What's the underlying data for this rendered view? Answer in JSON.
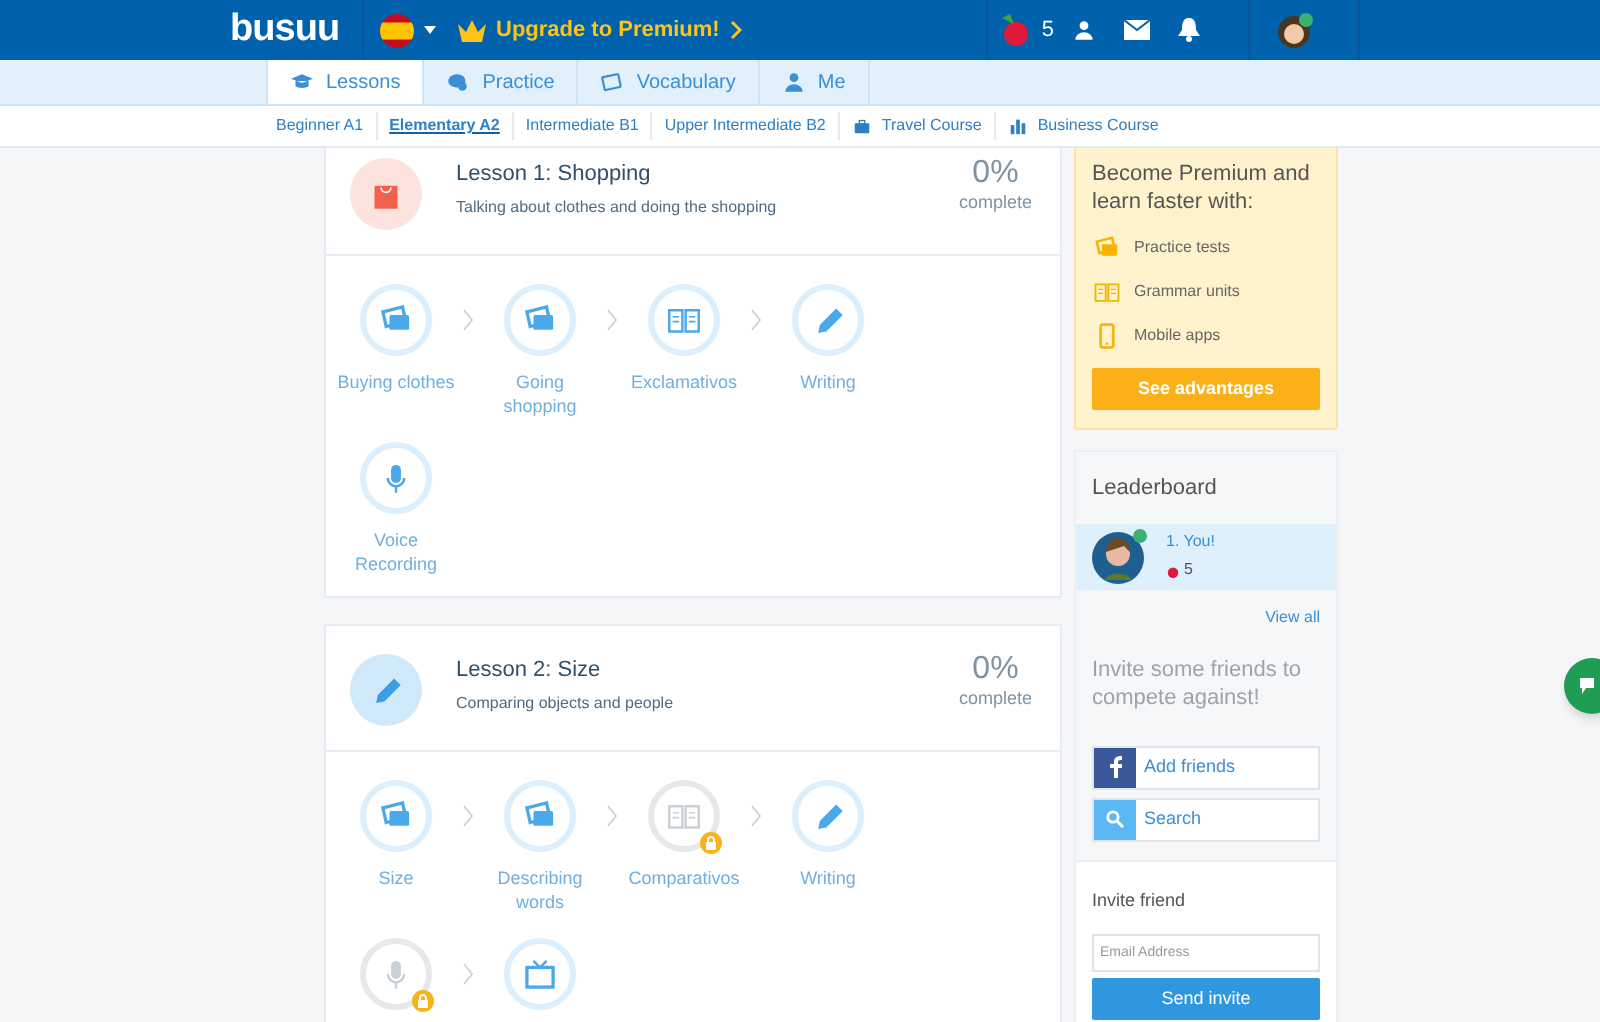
{
  "header": {
    "logo": "busuu",
    "upgrade": "Upgrade to Premium!",
    "points": "5"
  },
  "tabs": [
    {
      "label": "Lessons",
      "kind": "cap",
      "selected": true
    },
    {
      "label": "Practice",
      "kind": "chat",
      "selected": false
    },
    {
      "label": "Vocabulary",
      "kind": "card",
      "selected": false
    },
    {
      "label": "Me",
      "kind": "user",
      "selected": false
    }
  ],
  "levels": [
    {
      "label": "Beginner A1",
      "selected": false,
      "kind": "level"
    },
    {
      "label": "Elementary A2",
      "selected": true,
      "kind": "level"
    },
    {
      "label": "Intermediate B1",
      "selected": false,
      "kind": "level"
    },
    {
      "label": "Upper Intermediate B2",
      "selected": false,
      "kind": "level"
    },
    {
      "label": "Travel Course",
      "selected": false,
      "kind": "travel"
    },
    {
      "label": "Business Course",
      "selected": false,
      "kind": "business"
    }
  ],
  "lessons": [
    {
      "title": "Lesson 1: Shopping",
      "subtitle": "Talking about clothes and doing the shopping",
      "percent": "0%",
      "complete": "complete",
      "kind": "bag",
      "activities": [
        {
          "label": "Buying clothes",
          "kind": "cards",
          "locked": false
        },
        {
          "label": "Going shopping",
          "kind": "cards",
          "locked": false
        },
        {
          "label": "Exclamativos",
          "kind": "book",
          "locked": false
        },
        {
          "label": "Writing",
          "kind": "pencil",
          "locked": false
        },
        {
          "label": "Voice Recording",
          "kind": "mic",
          "locked": false
        }
      ]
    },
    {
      "title": "Lesson 2: Size",
      "subtitle": "Comparing objects and people",
      "percent": "0%",
      "complete": "complete",
      "kind": "pencil",
      "activities": [
        {
          "label": "Size",
          "kind": "cards",
          "locked": false
        },
        {
          "label": "Describing words",
          "kind": "cards",
          "locked": false
        },
        {
          "label": "Comparativos",
          "kind": "book",
          "locked": true
        },
        {
          "label": "Writing",
          "kind": "pencil",
          "locked": false
        },
        {
          "kind": "mic",
          "locked": true
        },
        {
          "kind": "tv",
          "locked": false
        }
      ]
    }
  ],
  "premium": {
    "title": "Become Premium and learn faster with:",
    "features": [
      {
        "label": "Practice tests",
        "kind": "cards"
      },
      {
        "label": "Grammar units",
        "kind": "book"
      },
      {
        "label": "Mobile apps",
        "kind": "phone"
      }
    ],
    "button": "See advantages"
  },
  "leaderboard": {
    "title": "Leaderboard",
    "entries": [
      {
        "name": "1. You!",
        "points": "5",
        "selected": true
      }
    ],
    "view_all": "View all",
    "invite_text": "Invite some friends to compete against!",
    "add_friends": "Add friends",
    "search": "Search"
  },
  "invite": {
    "title": "Invite friend",
    "placeholder": "Email Address",
    "button": "Send invite"
  }
}
